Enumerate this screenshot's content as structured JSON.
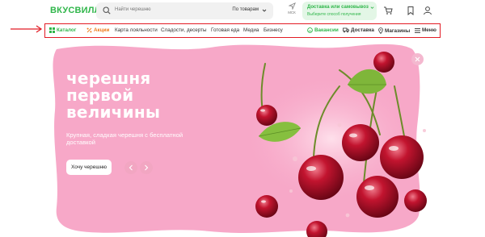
{
  "header": {
    "logo": "ВКУСВИЛЛ",
    "search_placeholder": "Найти черешню",
    "search_scope": "По товарам",
    "location": "МСК",
    "delivery_title": "Доставка или самовывоз",
    "delivery_subtitle": "Выберите способ получения"
  },
  "nav": {
    "catalog": "Каталог",
    "promo": "Акции",
    "loyalty": "Карта лояльности",
    "sweets": "Сладости, десерты",
    "ready_food": "Готовая еда",
    "media": "Медиа",
    "business": "Бизнесу",
    "vacancies": "Вакансии",
    "delivery": "Доставка",
    "stores": "Магазины",
    "menu": "Меню"
  },
  "hero": {
    "title_line1": "черешня",
    "title_line2": "первой",
    "title_line3": "величины",
    "subtitle": "Крупная, сладкая черешня с бесплатной доставкой",
    "cta": "Хочу черешню"
  },
  "colors": {
    "brand_green": "#2fb64a",
    "promo_orange": "#f07a1b",
    "hero_pink": "#f7a8c8",
    "annotation_red": "#e21b24"
  }
}
